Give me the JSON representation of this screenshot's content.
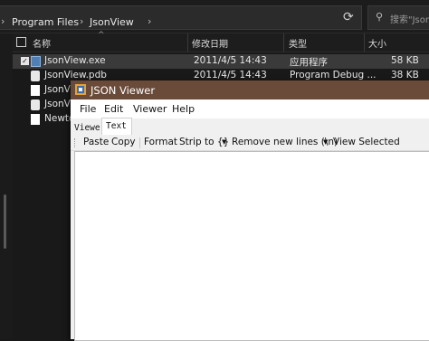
{
  "explorer": {
    "breadcrumb": [
      "Program Files",
      "JsonView"
    ],
    "search_placeholder": "搜索\"Json",
    "columns": {
      "name": "名称",
      "date": "修改日期",
      "type": "类型",
      "size": "大小"
    },
    "files": [
      {
        "name": "JsonView.exe",
        "date": "2011/4/5 14:43",
        "type": "应用程序",
        "size": "58 KB"
      },
      {
        "name": "JsonView.pdb",
        "date": "2011/4/5 14:43",
        "type": "Program Debug ...",
        "size": "38 KB"
      },
      {
        "name": "JsonVi",
        "date": "",
        "type": "",
        "size": ""
      },
      {
        "name": "JsonVi",
        "date": "",
        "type": "",
        "size": ""
      },
      {
        "name": "Newto",
        "date": "",
        "type": "",
        "size": ""
      }
    ]
  },
  "jsonviewer": {
    "title": "JSON Viewer",
    "menu": [
      "File",
      "Edit",
      "Viewer",
      "Help"
    ],
    "tabs": [
      "Viewer",
      "Text"
    ],
    "toolbar": {
      "paste": "Paste",
      "copy": "Copy",
      "format": "Format",
      "strip": "Strip to {}",
      "remove_lines": "Remove new lines (\\n)",
      "view_selected": "View Selected"
    }
  }
}
